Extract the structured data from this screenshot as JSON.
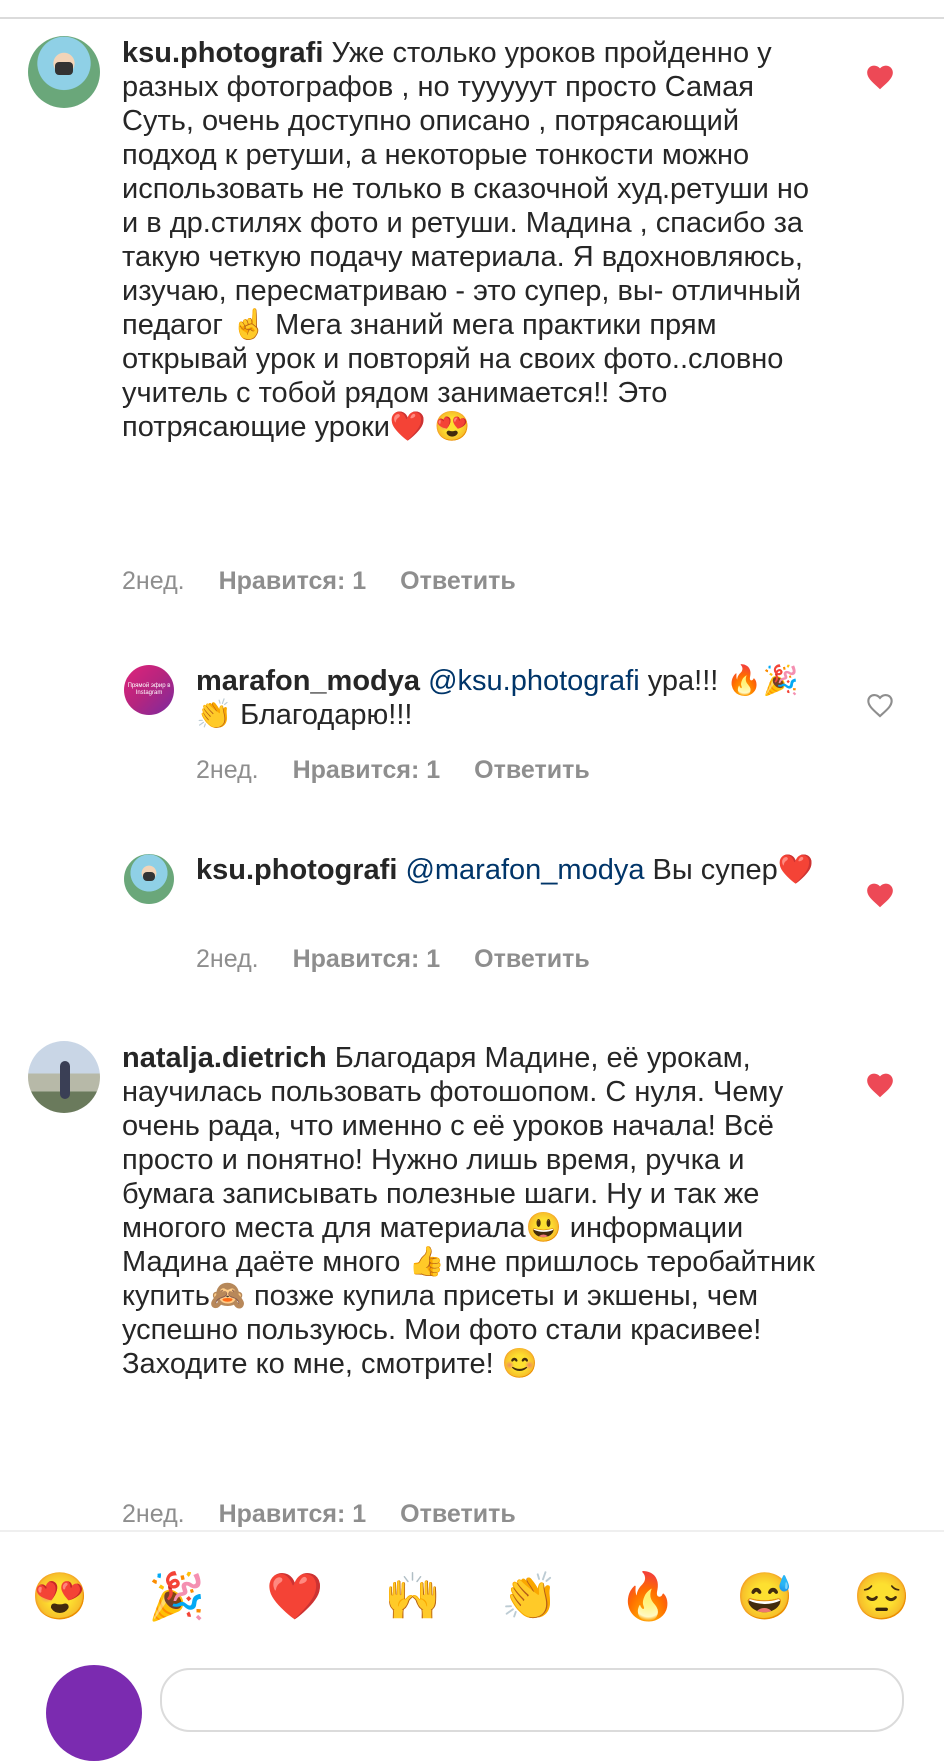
{
  "comments": [
    {
      "username": "ksu.photografi",
      "text": "Уже столько уроков пройденно у разных фотографов , но тууууут просто Самая Суть, очень доступно описано , потрясающий подход к ретуши, а некоторые тонкости можно использовать не только в сказочной худ.ретуши но и в др.стилях фото и ретуши. Мадина , спасибо за такую четкую подачу материала. Я вдохновляюсь, изучаю, пересматриваю - это супер, вы- отличный педагог ☝️ Мега знаний мега практики прям открывай урок и повторяй на своих фото..словно учитель с тобой рядом занимается!! Это потрясающие уроки❤️ 😍",
      "time": "2нед.",
      "likes": "Нравится: 1",
      "reply": "Ответить",
      "liked": true
    },
    {
      "username": "marafon_modya",
      "mention": "@ksu.photografi",
      "text": "ура!!! 🔥🎉👏 Благодарю!!!",
      "time": "2нед.",
      "likes": "Нравится: 1",
      "reply": "Ответить",
      "liked": false,
      "avatar_text": "Прямой эфир в Instagram"
    },
    {
      "username": "ksu.photografi",
      "mention": "@marafon_modya",
      "text": "Вы супер❤️",
      "time": "2нед.",
      "likes": "Нравится: 1",
      "reply": "Ответить",
      "liked": true
    },
    {
      "username": "natalja.dietrich",
      "text": "Благодаря Мадине, её урокам, научилась пользовать фотошопом. С нуля. Чему очень рада, что именно с её уроков начала! Всё просто и понятно! Нужно лишь время, ручка и бумага записывать полезные шаги. Ну и так же многого места для материала😃 информации Мадина даёте много 👍мне пришлось теробайтник купить🙈 позже купила присеты и экшены, чем успешно пользуюсь. Мои фото стали красивее! Заходите ко мне, смотрите! 😊",
      "time": "2нед.",
      "likes": "Нравится: 1",
      "reply": "Ответить",
      "liked": true
    }
  ],
  "emoji_bar": [
    "😍",
    "🎉",
    "❤️",
    "🙌",
    "👏",
    "🔥",
    "😅",
    "😔"
  ],
  "colors": {
    "heart_liked": "#ed4956",
    "heart_outline": "#8e8e8e",
    "mention": "#003569",
    "meta": "#8e8e8e"
  }
}
